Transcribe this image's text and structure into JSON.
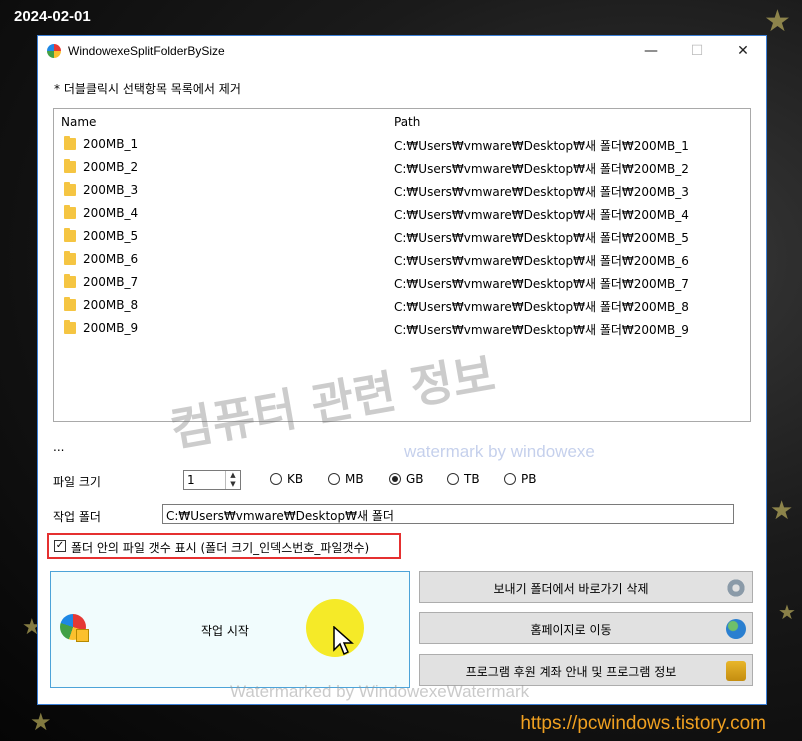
{
  "overlay": {
    "date": "2024-02-01",
    "url": "https://pcwindows.tistory.com",
    "watermark_main": "컴퓨터 관련 정보",
    "watermark_sub": "watermark by windowexe",
    "watermark_bottom": "Watermarked by WindowexeWatermark"
  },
  "window": {
    "title": "WindowexeSplitFolderBySize",
    "controls": {
      "minimize": "—",
      "maximize": "☐",
      "close": "✕"
    }
  },
  "hint": "* 더블클릭시 선택항목 목록에서 제거",
  "list": {
    "columns": {
      "name": "Name",
      "path": "Path"
    },
    "rows": [
      {
        "name": "200MB_1",
        "path": "C:₩Users₩vmware₩Desktop₩새 폴더₩200MB_1"
      },
      {
        "name": "200MB_2",
        "path": "C:₩Users₩vmware₩Desktop₩새 폴더₩200MB_2"
      },
      {
        "name": "200MB_3",
        "path": "C:₩Users₩vmware₩Desktop₩새 폴더₩200MB_3"
      },
      {
        "name": "200MB_4",
        "path": "C:₩Users₩vmware₩Desktop₩새 폴더₩200MB_4"
      },
      {
        "name": "200MB_5",
        "path": "C:₩Users₩vmware₩Desktop₩새 폴더₩200MB_5"
      },
      {
        "name": "200MB_6",
        "path": "C:₩Users₩vmware₩Desktop₩새 폴더₩200MB_6"
      },
      {
        "name": "200MB_7",
        "path": "C:₩Users₩vmware₩Desktop₩새 폴더₩200MB_7"
      },
      {
        "name": "200MB_8",
        "path": "C:₩Users₩vmware₩Desktop₩새 폴더₩200MB_8"
      },
      {
        "name": "200MB_9",
        "path": "C:₩Users₩vmware₩Desktop₩새 폴더₩200MB_9"
      }
    ]
  },
  "status_ellipsis": "...",
  "file_size": {
    "label": "파일 크기",
    "value": "1",
    "units": [
      "KB",
      "MB",
      "GB",
      "TB",
      "PB"
    ],
    "selected_unit": "GB"
  },
  "work_folder": {
    "label": "작업 폴더",
    "value": "C:₩Users₩vmware₩Desktop₩새 폴더"
  },
  "show_file_count": {
    "checked": true,
    "label": "폴더 안의 파일 갯수 표시 (폴더 크기_인덱스번호_파일갯수)"
  },
  "buttons": {
    "start": "작업 시작",
    "delete_sendto": "보내기 폴더에서 바로가기 삭제",
    "homepage": "홈페이지로 이동",
    "about": "프로그램 후원 계좌 안내 및 프로그램 정보"
  }
}
